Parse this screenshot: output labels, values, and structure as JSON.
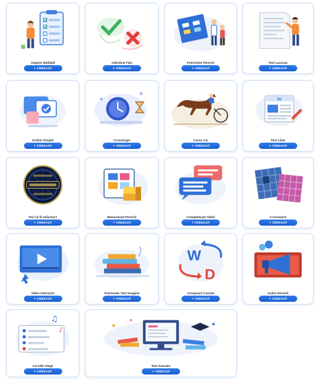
{
  "create_label": "CREEAZĂ",
  "create_icon": "magic-wand-icon",
  "accent_color": "#1f6ad8",
  "cards": [
    {
      "id": "alegere-multipla",
      "title": "Alegere Multiplă",
      "icon": "checklist-clipboard-icon"
    },
    {
      "id": "adevarat-fals",
      "title": "Adevărat Fals",
      "icon": "check-cross-icon"
    },
    {
      "id": "potriveste-perechi",
      "title": "Potrivește Perechi",
      "icon": "matching-board-icon"
    },
    {
      "id": "text-lacunar",
      "title": "Text Lacunar",
      "icon": "document-person-icon"
    },
    {
      "id": "ordine-simpla",
      "title": "Ordine Simplă",
      "icon": "ordered-cards-icon"
    },
    {
      "id": "cronologie",
      "title": "Cronologie",
      "icon": "clock-hourglass-icon"
    },
    {
      "id": "cursa-cai",
      "title": "Cursa Cai",
      "icon": "horse-race-icon"
    },
    {
      "id": "text-liber",
      "title": "Text Liber",
      "icon": "newspaper-icon"
    },
    {
      "id": "vrei-sa-fii-milionar",
      "title": "Vrei să fii milionar?",
      "icon": "millionaire-logo-icon"
    },
    {
      "id": "memoreaza-perechi",
      "title": "Memorează Perechi",
      "icon": "memory-cards-icon"
    },
    {
      "id": "completeaza-tabel",
      "title": "Completează Tabel",
      "icon": "speech-table-icon"
    },
    {
      "id": "crossword",
      "title": "Crossword",
      "icon": "crossword-grid-icon"
    },
    {
      "id": "video-interactiv",
      "title": "Video Interactiv",
      "icon": "video-play-icon"
    },
    {
      "id": "potriveste-text-imagine",
      "title": "Potrivește Text Imagine",
      "icon": "books-stack-icon"
    },
    {
      "id": "aranjeaza-cuvinte",
      "title": "Aranjează Cuvinte",
      "icon": "word-arrows-icon"
    },
    {
      "id": "audio-perechi",
      "title": "Audio Perechi",
      "icon": "megaphone-icon"
    },
    {
      "id": "asculta-alege",
      "title": "Ascultă Alege",
      "icon": "music-list-icon"
    },
    {
      "id": "test-sumativ",
      "title": "Test Sumativ",
      "icon": "computer-test-icon"
    }
  ]
}
